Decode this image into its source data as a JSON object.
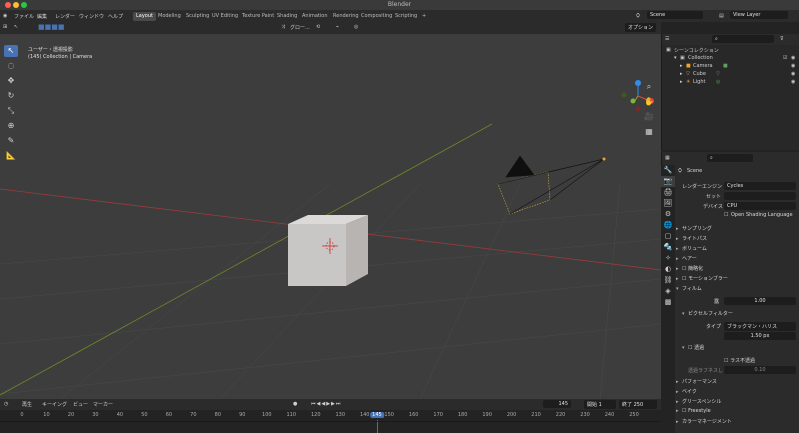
{
  "window": {
    "title": "Blender"
  },
  "colors": {
    "accent": "#4772b3",
    "close": "#ff5f57",
    "minimize": "#febc2e",
    "maximize": "#28c840",
    "frame_marker": "#4772b3"
  },
  "menu": [
    "ファイル",
    "編集",
    "レンダー",
    "ウィンドウ",
    "ヘルプ"
  ],
  "workspaces": [
    "Layout",
    "Modeling",
    "Sculpting",
    "UV Editing",
    "Texture Paint",
    "Shading",
    "Animation",
    "Rendering",
    "Compositing",
    "Scripting"
  ],
  "workspace_add": "+",
  "scene": {
    "name": "Scene",
    "view_layer": "View Layer"
  },
  "toolbar": {
    "mode": "オブジェクト...",
    "menus": [
      "ビュー",
      "選択",
      "追加",
      "オブジェクト"
    ],
    "transform": "グロー...",
    "options": "オプション"
  },
  "viewport": {
    "projection": "ユーザー・透視投影",
    "context": "(145) Collection | Camera",
    "tools": [
      "select-box-icon",
      "cursor-icon",
      "move-icon",
      "rotate-icon",
      "scale-icon",
      "transform-icon",
      "annotate-icon",
      "measure-icon"
    ]
  },
  "outliner": {
    "title": "シーンコレクション",
    "collection": "Collection",
    "items": [
      {
        "label": "Camera",
        "icon": "camera-icon"
      },
      {
        "label": "Cube",
        "icon": "mesh-icon"
      },
      {
        "label": "Light",
        "icon": "light-icon"
      }
    ]
  },
  "properties": {
    "search_placeholder": "",
    "scene_label": "Scene",
    "render_engine_label": "レンダーエンジン",
    "render_engine": "Cycles",
    "feature_set_label": "セット",
    "feature_set": "",
    "device_label": "デバイス",
    "device": "CPU",
    "osl_label": "Open Shading Language",
    "sections": [
      "サンプリング",
      "ライトパス",
      "ボリューム",
      "ヘアー",
      "簡略化",
      "モーションブラー",
      "フィルム"
    ],
    "film": {
      "exposure_label": "露",
      "exposure": "1.00",
      "pixel_filter": "ピクセルフィルター",
      "type_label": "タイプ",
      "type": "ブラックマン・ハリス",
      "width": "1.50 px",
      "transparent": "透過",
      "transparent_glass": "ラス不透過",
      "roughness_label": "透過ラフネスしきい値",
      "roughness": "0.10"
    },
    "bottom_sections": [
      "パフォーマンス",
      "ベイク",
      "グリースペンシル",
      "Freestyle",
      "カラーマネージメント"
    ]
  },
  "timeline": {
    "menus": [
      "再生",
      "キーイング",
      "ビュー",
      "マーカー"
    ],
    "current_frame": "145",
    "start_label": "開始",
    "start": "1",
    "end_label": "終了",
    "end": "250",
    "ticks": [
      "0",
      "10",
      "20",
      "30",
      "40",
      "50",
      "60",
      "70",
      "80",
      "90",
      "100",
      "110",
      "120",
      "130",
      "140",
      "145",
      "150",
      "160",
      "170",
      "180",
      "190",
      "200",
      "210",
      "220",
      "230",
      "240",
      "250"
    ]
  }
}
